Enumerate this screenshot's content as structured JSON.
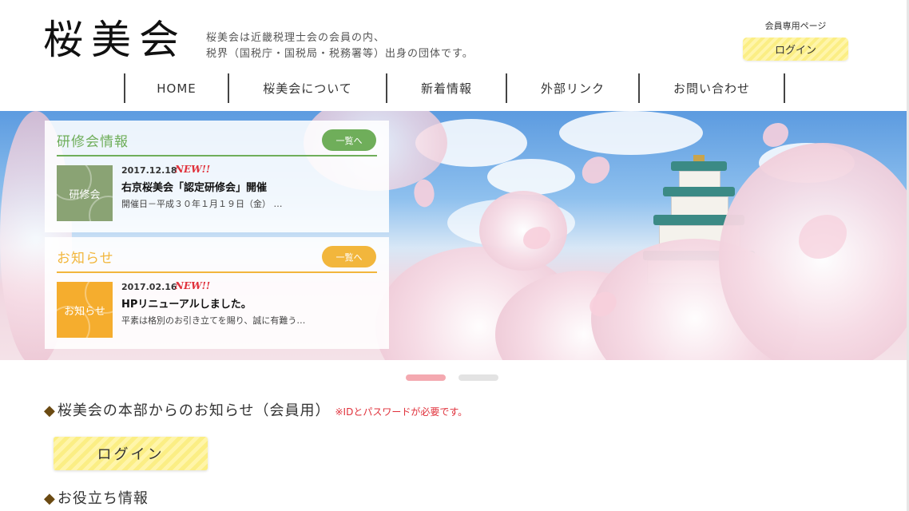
{
  "header": {
    "logo": "桜美会",
    "tagline_line1": "桜美会は近畿税理士会の会員の内、",
    "tagline_line2": "税界（国税庁・国税局・税務署等）出身の団体です。",
    "member_label": "会員専用ページ",
    "login_label": "ログイン"
  },
  "nav": {
    "items": [
      {
        "label": "HOME"
      },
      {
        "label": "桜美会について"
      },
      {
        "label": "新着情報"
      },
      {
        "label": "外部リンク"
      },
      {
        "label": "お問い合わせ"
      }
    ]
  },
  "panels": {
    "training": {
      "title": "研修会情報",
      "more_label": "一覧へ",
      "thumb_label": "研修会",
      "date": "2017.12.18",
      "new_badge": "NEW!!",
      "entry_title": "右京桜美会「認定研修会」開催",
      "excerpt": "開催日－平成３０年１月１９日（金） …",
      "accent": "#6fae5a"
    },
    "notice": {
      "title": "お知らせ",
      "more_label": "一覧へ",
      "thumb_label": "お知らせ",
      "date": "2017.02.16",
      "new_badge": "NEW!!",
      "entry_title": "HPリニューアルしました。",
      "excerpt": "平素は格別のお引き立てを賜り、誠に有難う…",
      "accent": "#f2b63c"
    }
  },
  "slider": {
    "active_index": 0,
    "count": 2,
    "active_color": "#f4a9b0",
    "inactive_color": "#e3e3e3"
  },
  "main": {
    "members_heading": "桜美会の本部からのお知らせ（会員用）",
    "members_note": "※IDとパスワードが必要です。",
    "login_button": "ログイン",
    "useful_heading": "お役立ち情報"
  }
}
